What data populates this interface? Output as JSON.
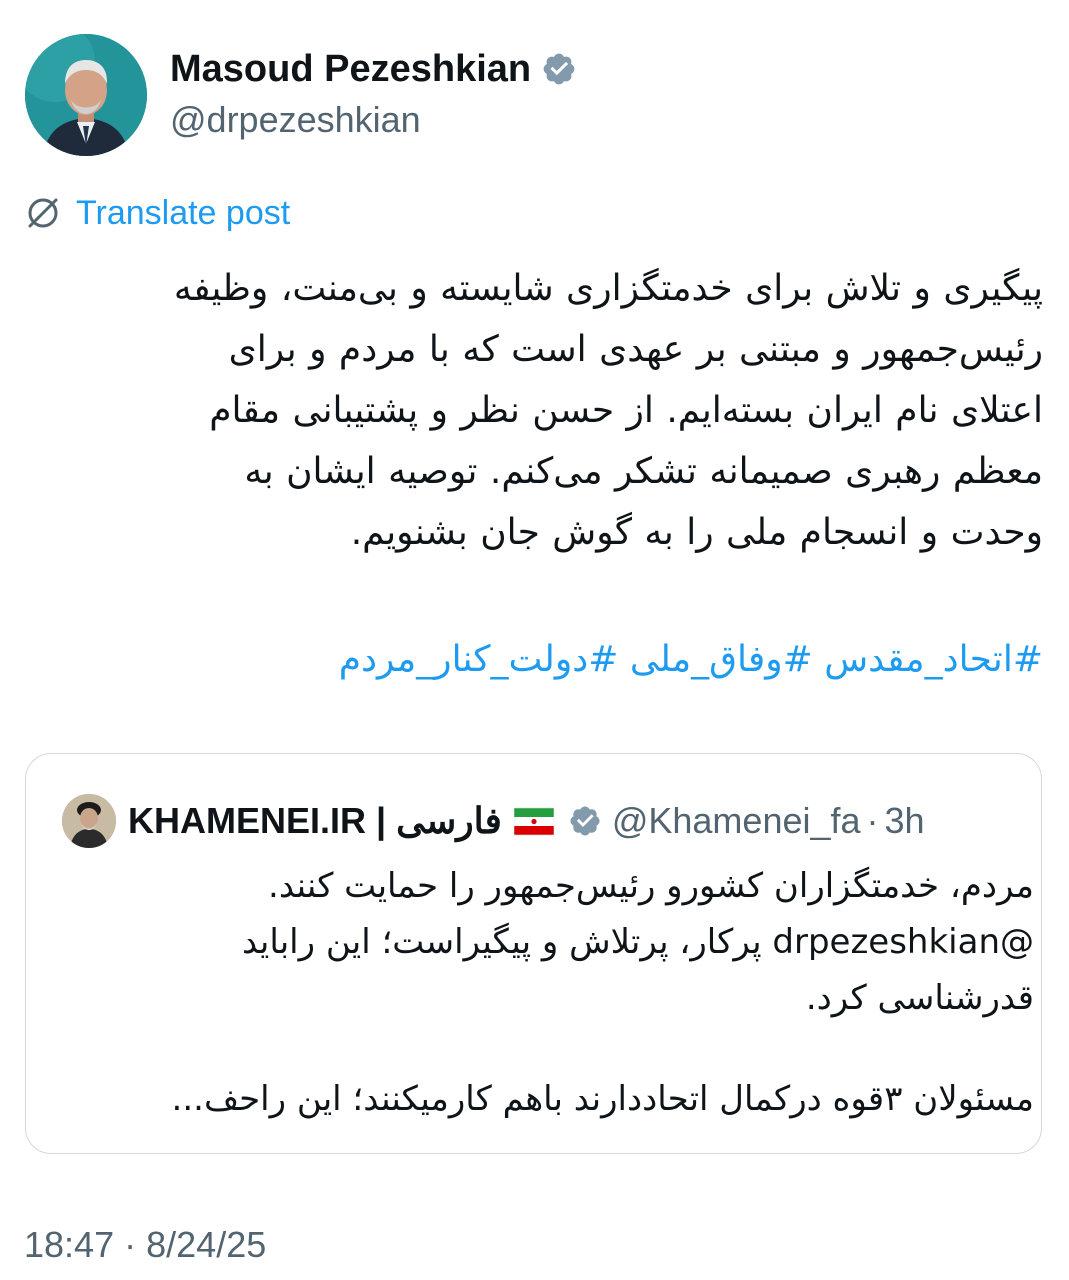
{
  "author": {
    "name": "Masoud Pezeshkian",
    "handle": "@drpezeshkian",
    "verified": true,
    "avatar_icon": "profile-photo"
  },
  "translate": {
    "label": "Translate post",
    "icon": "translate-globe-icon"
  },
  "post": {
    "lines": [
      "پیگیری و تلاش برای خدمتگزاری شایسته و بی‌منت، وظیفه",
      "رئیس‌جمهور و مبتنی بر عهدی است که با مردم و برای",
      "اعتلای نام ایران بسته‌ایم. از حسن نظر و پشتیبانی مقام",
      "معظم رهبری صمیمانه تشکر می‌کنم. توصیه ایشان به",
      "وحدت و انسجام ملی را به گوش جان بشنویم."
    ],
    "hashtags": [
      "#اتحاد_مقدس",
      "#وفاق_ملی",
      "#دولت_کنار_مردم"
    ]
  },
  "quote": {
    "name": "KHAMENEI.IR | فارسی",
    "flag_icon": "iran-flag-icon",
    "verified": true,
    "handle": "@Khamenei_fa",
    "separator": "·",
    "time": "3h",
    "lines": [
      "مردم، خدمتگزاران کشورو رئیس‌جمهور را حمایت کنند.",
      "@drpezeshkian پرکار، پرتلاش و پیگیراست؛ این راباید",
      "قدرشناسی کرد."
    ],
    "last_line": "مسئولان ۳قوه درکمال اتحاددارند باهم کارمیکنند؛ این راحف..."
  },
  "timestamp": {
    "time": "18:47",
    "separator": "·",
    "date": "8/24/25"
  },
  "colors": {
    "link": "#1d9bf0",
    "secondary_text": "#536471",
    "primary_text": "#0f1419",
    "verified_badge": "#829aab",
    "border": "#cfd9de"
  }
}
